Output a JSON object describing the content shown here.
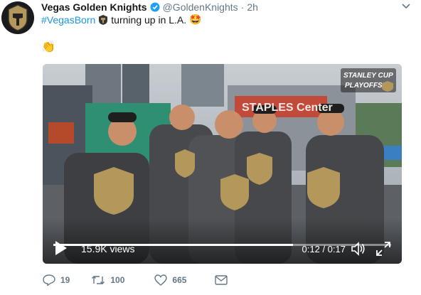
{
  "tweet": {
    "author_name": "Vegas Golden Knights",
    "handle": "@GoldenKnights",
    "separator": "·",
    "time": "2h",
    "hashtag": "#VegasBorn",
    "text": " turning up in L.A.",
    "emoji_star_eyes": "🤩",
    "emoji_clap": "👏"
  },
  "video": {
    "badge_line1": "STANLEY CUP",
    "badge_line2": "PLAYOFFS",
    "arena_sign": "STAPLES Center",
    "views": "15.9K views",
    "duration": "0:12 / 0:17",
    "progress": 0.71
  },
  "actions": {
    "replies": "19",
    "retweets": "100",
    "likes": "665"
  },
  "colors": {
    "hashtag": "#1b95e0",
    "verified": "#1da1f2",
    "muted": "#657786",
    "gold": "#b4975a"
  }
}
